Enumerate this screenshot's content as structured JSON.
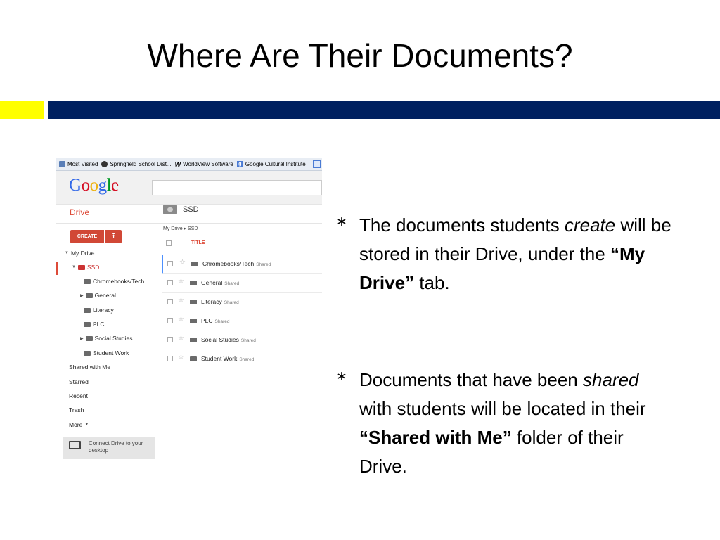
{
  "slide": {
    "title": "Where Are Their Documents?"
  },
  "colors": {
    "accent_yellow": "#ffff00",
    "accent_navy": "#002060",
    "drive_red": "#dd4b39"
  },
  "screenshot": {
    "bookmarks": [
      {
        "label": "Most Visited",
        "icon": "bookmark-folder-icon"
      },
      {
        "label": "Springfield School Dist...",
        "icon": "site-icon"
      },
      {
        "label": "WorldView Software",
        "icon": "worldview-icon"
      },
      {
        "label": "Google Cultural Institute",
        "icon": "google-icon"
      }
    ],
    "logo": "Google",
    "drive_label": "Drive",
    "folder_header": "SSD",
    "create_label": "CREATE",
    "upload_icon": "upload-icon",
    "nav": {
      "my_drive": "My Drive",
      "ssd": "SSD",
      "folders": [
        "Chromebooks/Tech",
        "General",
        "Literacy",
        "PLC",
        "Social Studies",
        "Student Work"
      ],
      "shared_with_me": "Shared with Me",
      "starred": "Starred",
      "recent": "Recent",
      "trash": "Trash",
      "more": "More"
    },
    "connect_text": "Connect Drive to your desktop",
    "breadcrumb": {
      "root": "My Drive",
      "current": "SSD"
    },
    "title_column": "TITLE",
    "files": [
      {
        "name": "Chromebooks/Tech",
        "tag": "Shared"
      },
      {
        "name": "General",
        "tag": "Shared"
      },
      {
        "name": "Literacy",
        "tag": "Shared"
      },
      {
        "name": "PLC",
        "tag": "Shared"
      },
      {
        "name": "Social Studies",
        "tag": "Shared"
      },
      {
        "name": "Student Work",
        "tag": "Shared"
      }
    ]
  },
  "bullets": [
    {
      "symbol": "∗",
      "parts": [
        {
          "text": "The documents students ",
          "style": "normal"
        },
        {
          "text": "create",
          "style": "italic"
        },
        {
          "text": " will be stored in their Drive, under the ",
          "style": "normal"
        },
        {
          "text": "“My Drive”",
          "style": "bold"
        },
        {
          "text": " tab.",
          "style": "normal"
        }
      ]
    },
    {
      "symbol": "∗",
      "parts": [
        {
          "text": "Documents that have been ",
          "style": "normal"
        },
        {
          "text": "shared",
          "style": "italic"
        },
        {
          "text": " with students will be located in their ",
          "style": "normal"
        },
        {
          "text": "“Shared with Me”",
          "style": "bold"
        },
        {
          "text": " folder of their Drive.",
          "style": "normal"
        }
      ]
    }
  ]
}
